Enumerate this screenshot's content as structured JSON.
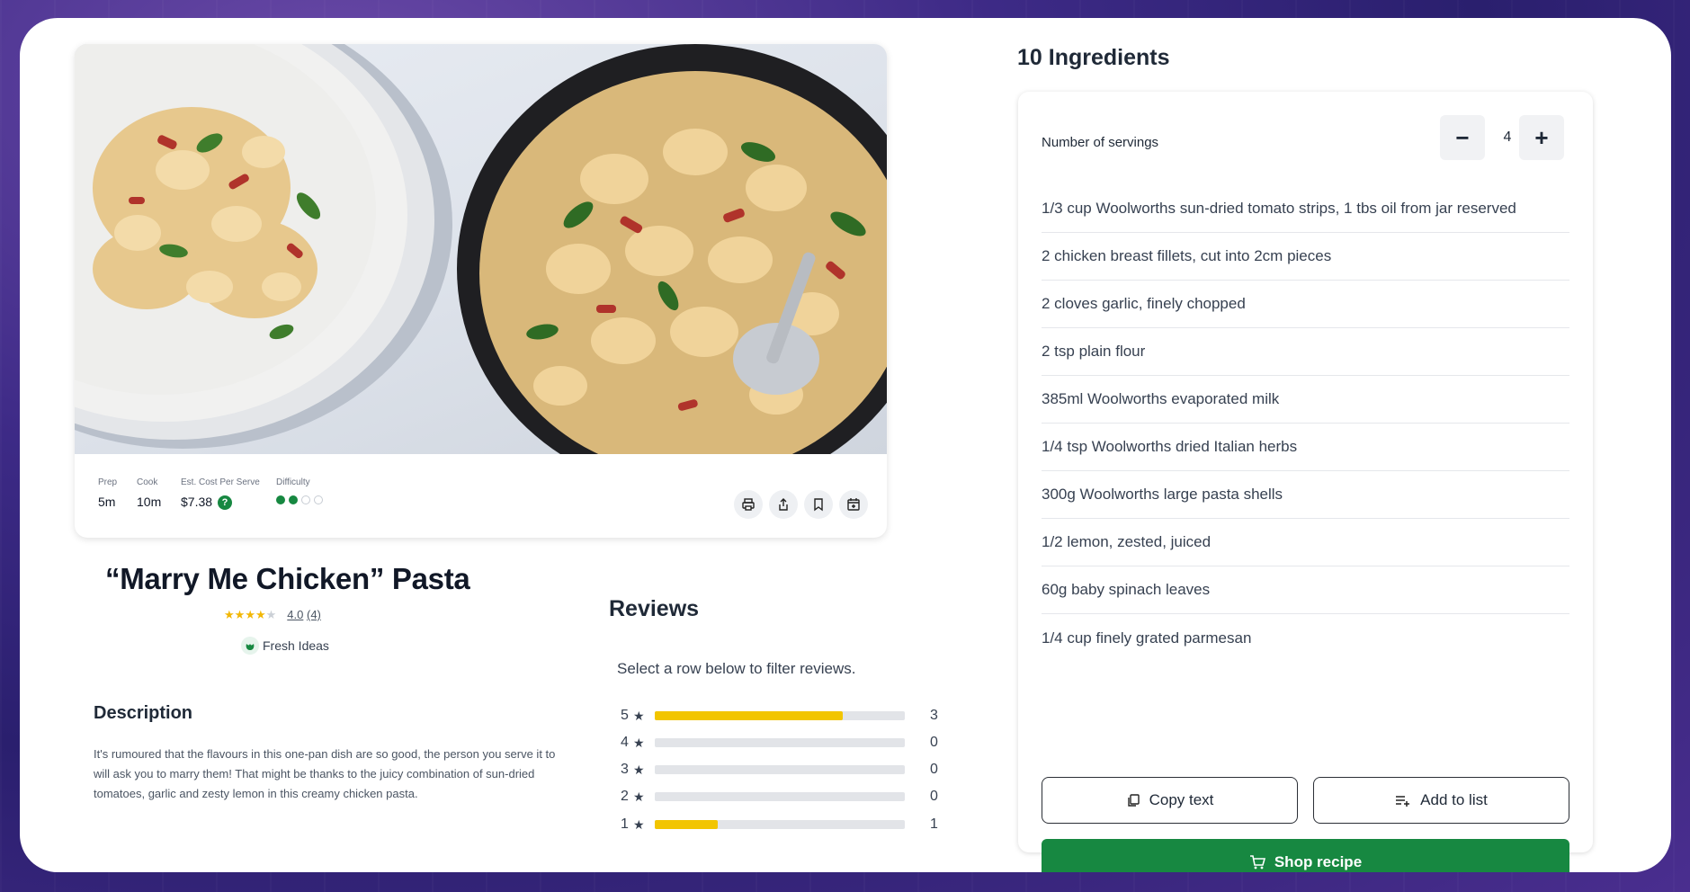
{
  "recipe": {
    "title": "“Marry Me Chicken” Pasta",
    "rating_value": "4.0",
    "rating_count": "(4)",
    "rating_stars": 4,
    "brand": "Fresh Ideas"
  },
  "meta": {
    "prep_label": "Prep",
    "prep_value": "5m",
    "cook_label": "Cook",
    "cook_value": "10m",
    "cost_label": "Est. Cost Per Serve",
    "cost_value": "$7.38",
    "help_glyph": "?",
    "difficulty_label": "Difficulty",
    "difficulty_level": 2,
    "difficulty_max": 4
  },
  "actions": [
    "print-icon",
    "share-icon",
    "bookmark-icon",
    "calendar-add-icon"
  ],
  "description": {
    "heading": "Description",
    "text": "It's rumoured that the flavours in this one-pan dish are so good, the person you serve it to will ask you to marry them! That might be thanks to the juicy combination of sun-dried tomatoes, garlic and zesty lemon in this creamy chicken pasta."
  },
  "reviews": {
    "heading": "Reviews",
    "note": "Select a row below to filter reviews.",
    "star_glyph": "★",
    "rows": [
      {
        "stars": "5",
        "count": "3",
        "fraction": 0.75
      },
      {
        "stars": "4",
        "count": "0",
        "fraction": 0
      },
      {
        "stars": "3",
        "count": "0",
        "fraction": 0
      },
      {
        "stars": "2",
        "count": "0",
        "fraction": 0
      },
      {
        "stars": "1",
        "count": "1",
        "fraction": 0.25
      }
    ]
  },
  "ingredients": {
    "heading": "10 Ingredients",
    "servings_label": "Number of servings",
    "servings_value": "4",
    "minus": "−",
    "plus": "+",
    "items": [
      "1/3 cup Woolworths sun-dried tomato strips, 1 tbs oil from jar reserved",
      "2 chicken breast fillets, cut into 2cm pieces",
      "2 cloves garlic, finely chopped",
      "2 tsp plain flour",
      "385ml Woolworths evaporated milk",
      "1/4 tsp Woolworths dried Italian herbs",
      "300g Woolworths large pasta shells",
      "1/2 lemon, zested, juiced",
      "60g baby spinach leaves",
      "1/4 cup finely grated parmesan"
    ],
    "copy_label": "Copy text",
    "add_label": "Add to list",
    "shop_label": "Shop recipe"
  },
  "colors": {
    "brand_green": "#178841",
    "rating_yellow": "#f2c500"
  }
}
